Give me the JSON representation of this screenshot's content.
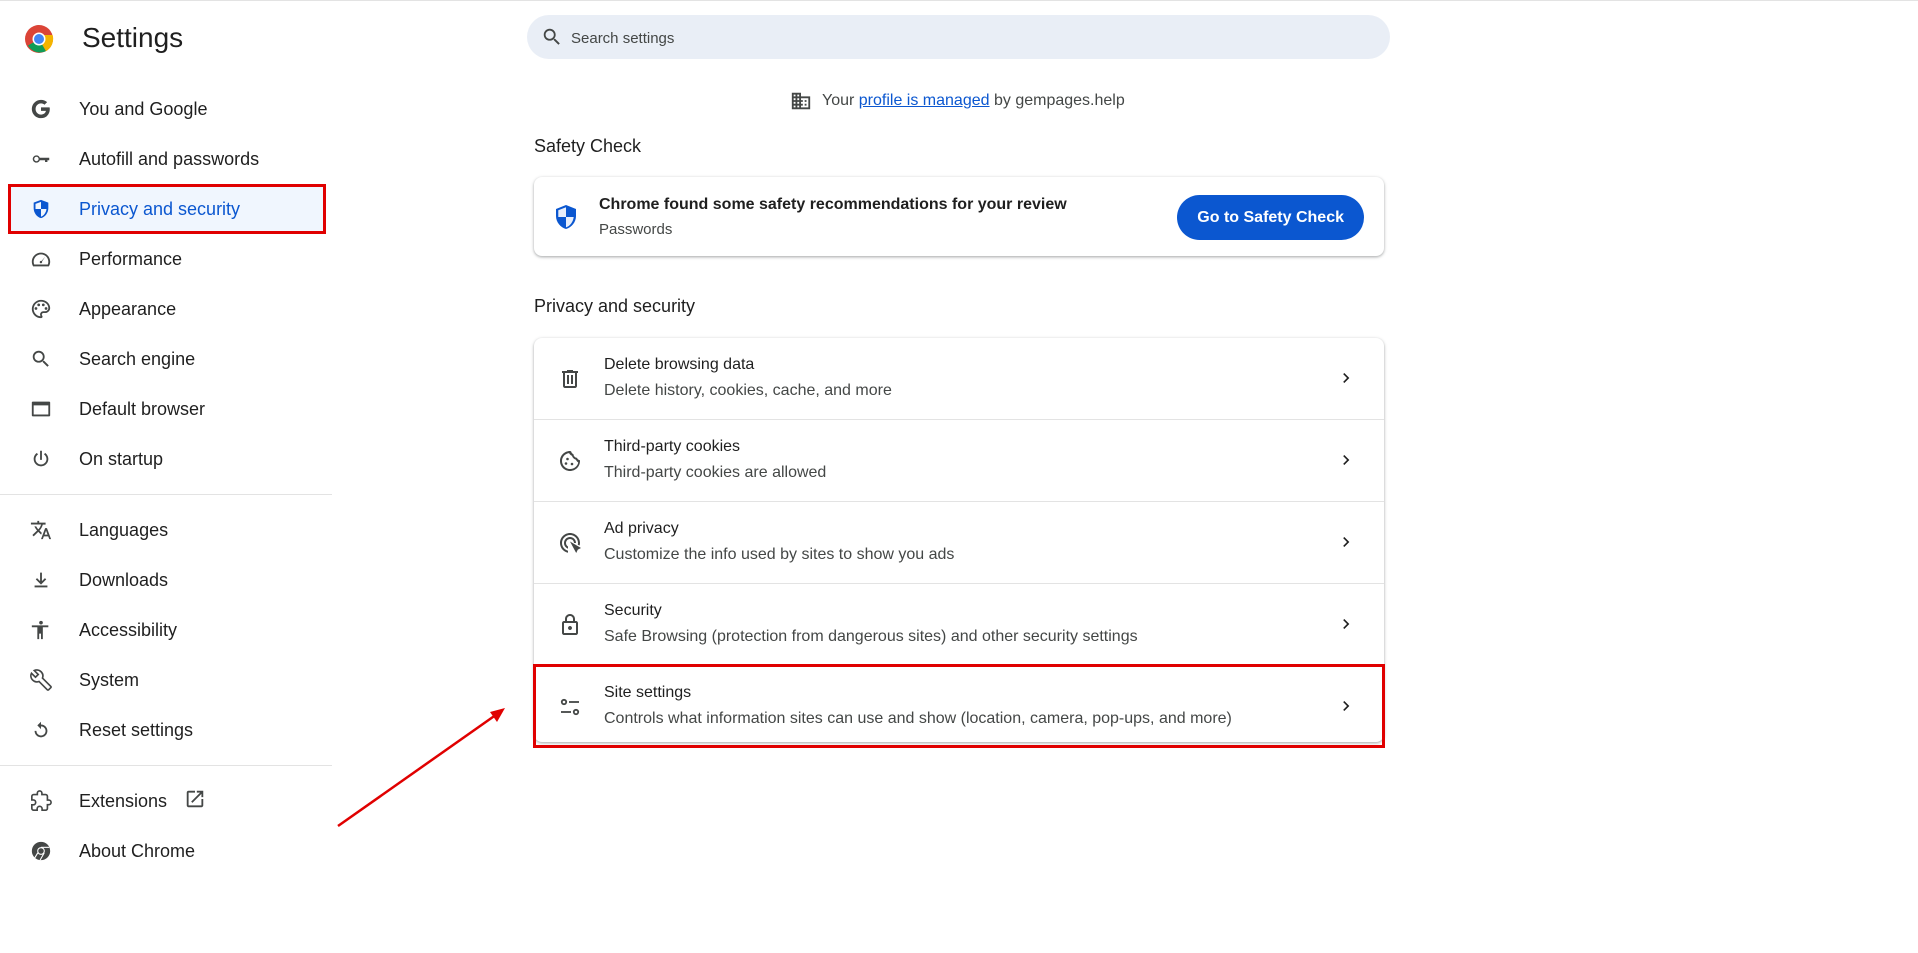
{
  "app": {
    "title": "Settings"
  },
  "search": {
    "placeholder": "Search settings"
  },
  "managed": {
    "prefix": "Your",
    "link": "profile is managed",
    "suffix": "by gempages.help"
  },
  "sidebar": {
    "items": [
      {
        "label": "You and Google",
        "icon": "google-g-icon"
      },
      {
        "label": "Autofill and passwords",
        "icon": "key-icon"
      },
      {
        "label": "Privacy and security",
        "icon": "shield-icon",
        "active": true
      },
      {
        "label": "Performance",
        "icon": "speedometer-icon"
      },
      {
        "label": "Appearance",
        "icon": "palette-icon"
      },
      {
        "label": "Search engine",
        "icon": "search-icon"
      },
      {
        "label": "Default browser",
        "icon": "browser-window-icon"
      },
      {
        "label": "On startup",
        "icon": "power-icon"
      }
    ],
    "items2": [
      {
        "label": "Languages",
        "icon": "translate-icon"
      },
      {
        "label": "Downloads",
        "icon": "download-icon"
      },
      {
        "label": "Accessibility",
        "icon": "accessibility-icon"
      },
      {
        "label": "System",
        "icon": "wrench-icon"
      },
      {
        "label": "Reset settings",
        "icon": "reset-icon"
      }
    ],
    "items3": [
      {
        "label": "Extensions",
        "icon": "puzzle-icon"
      },
      {
        "label": "About Chrome",
        "icon": "chrome-icon"
      }
    ]
  },
  "safety_check": {
    "section_title": "Safety Check",
    "title": "Chrome found some safety recommendations for your review",
    "subtitle": "Passwords",
    "button": "Go to Safety Check"
  },
  "privacy": {
    "section_title": "Privacy and security",
    "rows": [
      {
        "title": "Delete browsing data",
        "subtitle": "Delete history, cookies, cache, and more",
        "icon": "trash-icon"
      },
      {
        "title": "Third-party cookies",
        "subtitle": "Third-party cookies are allowed",
        "icon": "cookie-icon"
      },
      {
        "title": "Ad privacy",
        "subtitle": "Customize the info used by sites to show you ads",
        "icon": "ad-privacy-icon"
      },
      {
        "title": "Security",
        "subtitle": "Safe Browsing (protection from dangerous sites) and other security settings",
        "icon": "lock-icon"
      },
      {
        "title": "Site settings",
        "subtitle": "Controls what information sites can use and show (location, camera, pop-ups, and more)",
        "icon": "tune-icon",
        "highlighted": true
      }
    ]
  },
  "colors": {
    "accent": "#0b57d0",
    "highlight": "#e00000",
    "search_bg": "#e9eef6"
  }
}
